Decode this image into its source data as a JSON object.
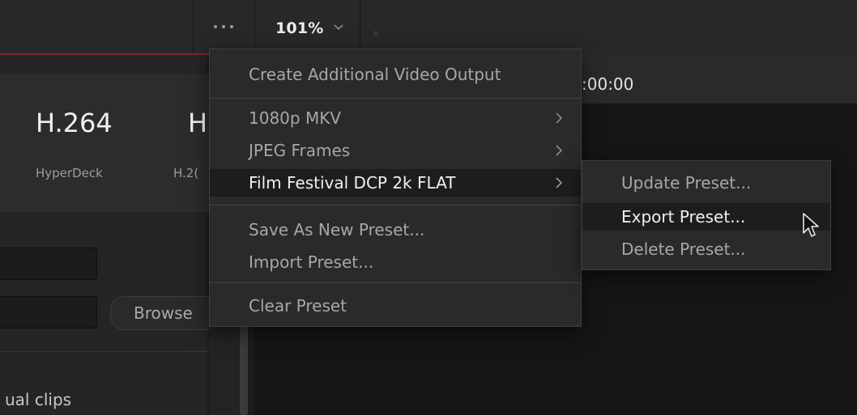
{
  "toolbar": {
    "zoom_value": "101%",
    "icons": [
      "more-options-icon",
      "chevron-down-icon"
    ]
  },
  "left_panel": {
    "presets": [
      {
        "title": "H.264",
        "subtitle": "HyperDeck"
      },
      {
        "title": "H",
        "subtitle": "H.2("
      }
    ],
    "browse_label": "Browse",
    "clips_text": "ual clips"
  },
  "viewer": {
    "timecode": ":00:00"
  },
  "options_menu": {
    "items": [
      {
        "label": "Create Additional Video Output"
      },
      {
        "label": "1080p MKV",
        "submenu": true
      },
      {
        "label": "JPEG Frames",
        "submenu": true
      },
      {
        "label": "Film Festival DCP 2k FLAT",
        "submenu": true,
        "highlighted": true
      },
      {
        "label": "Save As New Preset..."
      },
      {
        "label": "Import Preset..."
      },
      {
        "label": "Clear Preset"
      }
    ]
  },
  "preset_submenu": {
    "items": [
      {
        "label": "Update Preset..."
      },
      {
        "label": "Export Preset...",
        "highlighted": true
      },
      {
        "label": "Delete Preset..."
      }
    ]
  },
  "colors": {
    "menu_bg": "#2a2a2c",
    "highlight_bg": "#1d1d1f",
    "accent_line": "#7a2a26"
  }
}
